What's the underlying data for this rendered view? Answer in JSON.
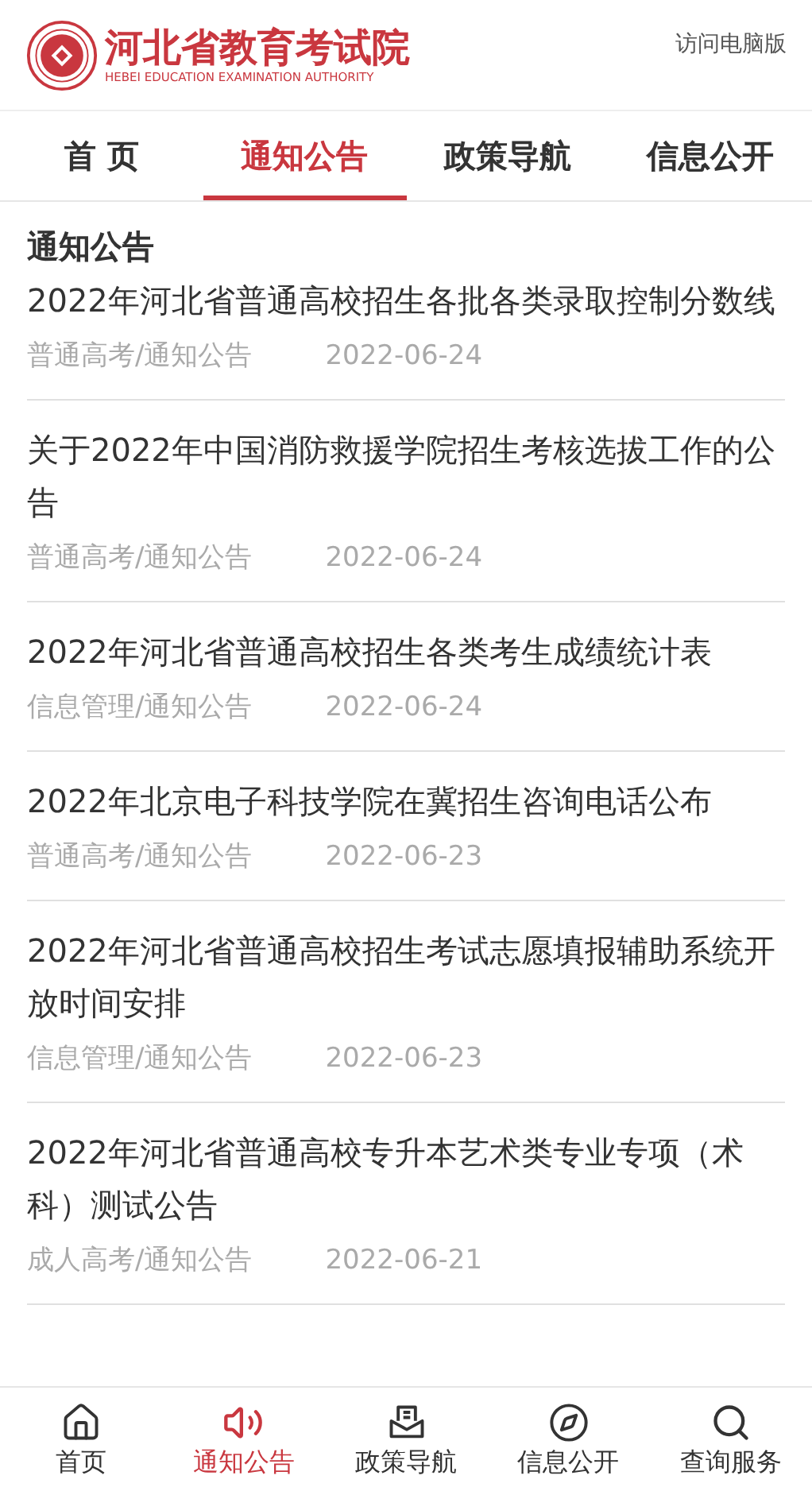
{
  "header": {
    "logo_title": "河北省教育考试院",
    "logo_subtitle": "HEBEI EDUCATION EXAMINATION AUTHORITY",
    "desktop_link": "访问电脑版"
  },
  "tabs": [
    {
      "label": "首 页",
      "selected": false
    },
    {
      "label": "通知公告",
      "selected": true
    },
    {
      "label": "政策导航",
      "selected": false
    },
    {
      "label": "信息公开",
      "selected": false
    }
  ],
  "section_title": "通知公告",
  "articles": [
    {
      "title": "2022年河北省普通高校招生各批各类录取控制分数线",
      "category": "普通高考/通知公告",
      "date": "2022-06-24"
    },
    {
      "title": "关于2022年中国消防救援学院招生考核选拔工作的公告",
      "category": "普通高考/通知公告",
      "date": "2022-06-24"
    },
    {
      "title": "2022年河北省普通高校招生各类考生成绩统计表",
      "category": "信息管理/通知公告",
      "date": "2022-06-24"
    },
    {
      "title": "2022年北京电子科技学院在冀招生咨询电话公布",
      "category": "普通高考/通知公告",
      "date": "2022-06-23"
    },
    {
      "title": "2022年河北省普通高校招生考试志愿填报辅助系统开放时间安排",
      "category": "信息管理/通知公告",
      "date": "2022-06-23"
    },
    {
      "title": "2022年河北省普通高校专升本艺术类专业专项（术科）测试公告",
      "category": "成人高考/通知公告",
      "date": "2022-06-21"
    }
  ],
  "bottom_nav": [
    {
      "kind": "home",
      "label": "首页",
      "selected": false
    },
    {
      "kind": "notice",
      "label": "通知公告",
      "selected": true
    },
    {
      "kind": "policy",
      "label": "政策导航",
      "selected": false
    },
    {
      "kind": "info",
      "label": "信息公开",
      "selected": false
    },
    {
      "kind": "search",
      "label": "查询服务",
      "selected": false
    }
  ]
}
